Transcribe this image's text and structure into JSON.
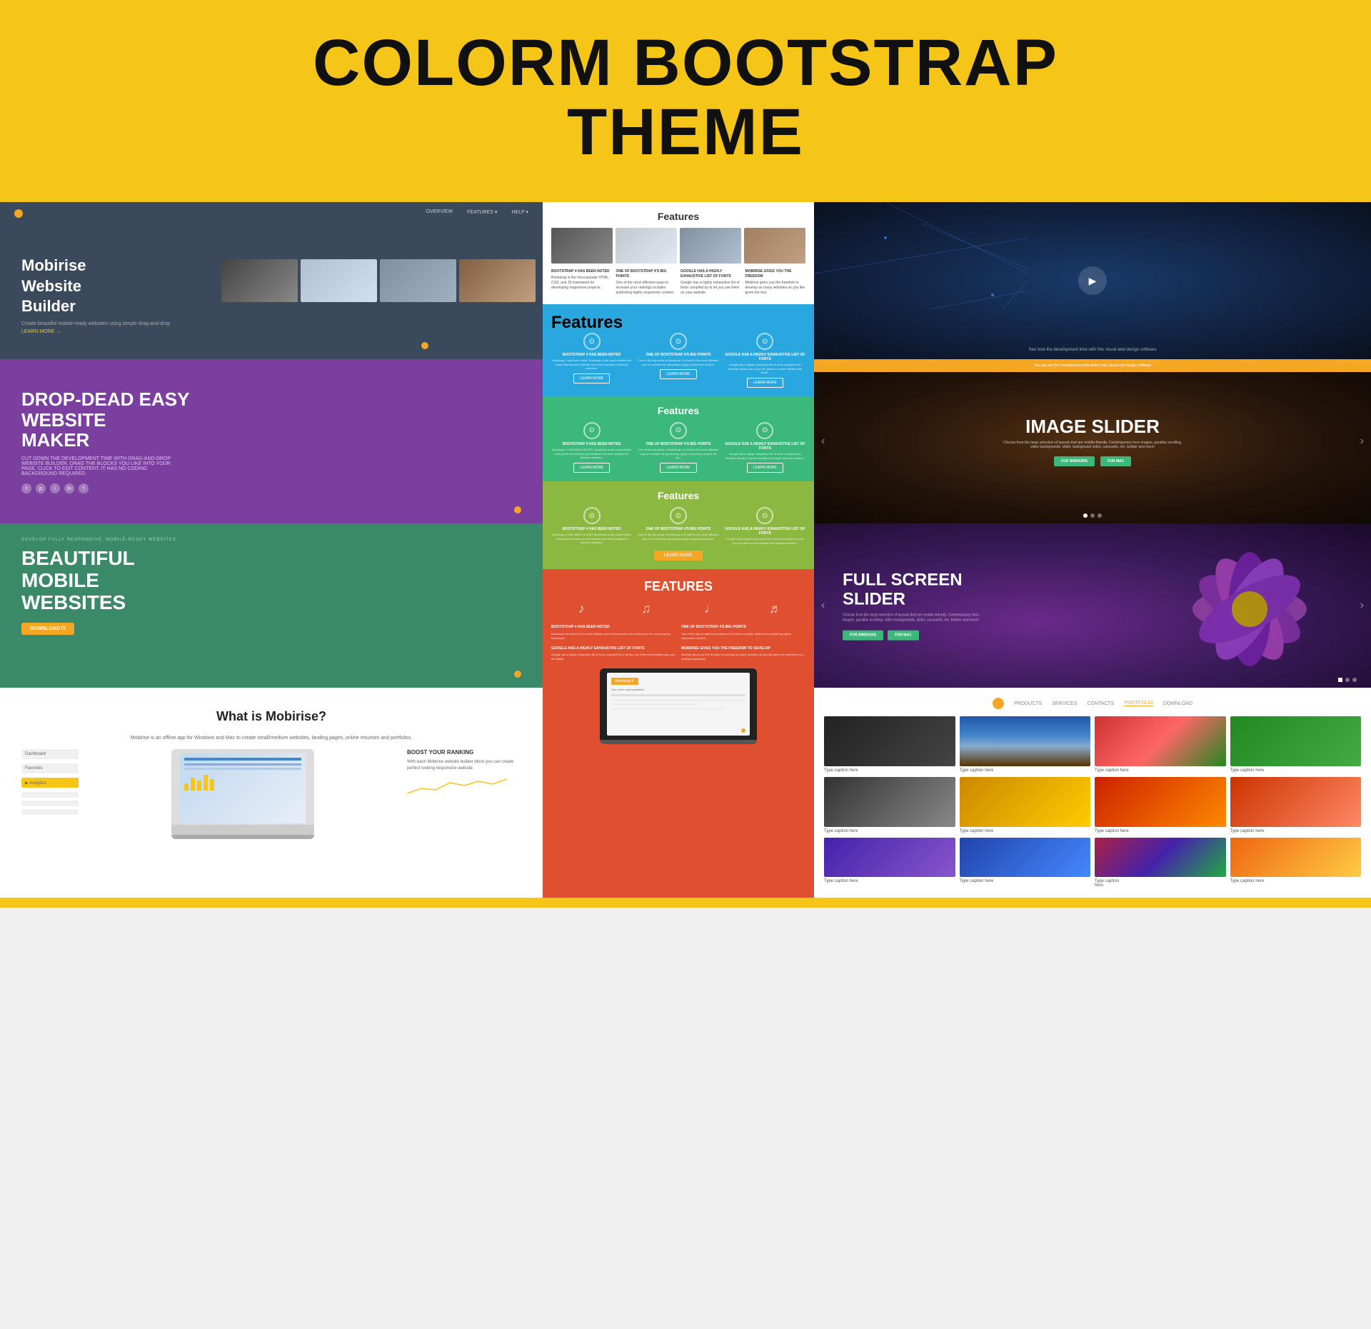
{
  "header": {
    "title": "COLORM BOOTSTRAP",
    "title2": "THEME",
    "bg": "#f5c518"
  },
  "left": {
    "mobirise": {
      "title": "Mobirise\nWebsite\nBuilder",
      "subtitle": "Create beautiful mobile-ready websites using simple drag-and-drop",
      "link": "LEARN MORE →",
      "nav": [
        "OVERVIEW",
        "FEATURES ▾",
        "HELP ▾"
      ]
    },
    "purple": {
      "heading": "DROP-DEAD EASY\nWEBSITE\nMAKER",
      "desc": "CUT DOWN THE DEVELOPMENT TIME WITH DRAG-AND-DROP WEBSITE BUILDER. DRAG THE BLOCKS YOU LIKE INTO YOUR PAGE, CLICK TO EDIT CONTENT. IT HAS NO CODING BACKGROUND REQUIRED."
    },
    "green": {
      "label": "DEVELOP FULLY RESPONSIVE, MOBILE-READY WEBSITES",
      "heading": "BEAUTIFUL\nMOBILE\nWEBSITES",
      "btn": "DOWNLOAD IT"
    },
    "white": {
      "heading": "What is Mobirise?",
      "text": "Mobirise is an offline app for Windows and Mac to create small/medium websites, landing pages, online resumes and portfolios.",
      "sidebar_items": [
        "Dashboard",
        "Favorites",
        "▶ Analytics"
      ],
      "boost_title": "BOOST YOUR RANKING",
      "boost_text": "With each Mobirise website builder block you can create perfect looking responsive website."
    }
  },
  "middle": {
    "feat1": {
      "title": "Features",
      "thumbs": [
        "office-1",
        "office-2",
        "tablet",
        "laptop"
      ],
      "cols": [
        {
          "title": "BOOTSTRAP 4 HAS BEEN NOTED",
          "text": "Bootstrap is the most popular HTML, CSS, and JS framework for developing responsive projects on the web."
        },
        {
          "title": "ONE OF BOOTSTRAP 4'S BIG POINTS",
          "text": "One of the most effective ways to increase your rankings includes publishing highly responsive content for you."
        },
        {
          "title": "GOOGLE HAS A HIGHLY EXHAUSTIVE LIST OF FONTS",
          "text": "Google has a highly exhaustive list of fonts compiled by to let you use them on publishing website."
        },
        {
          "title": "MOBIRISE GIVES YOU THE FREEDOM TO DEVELOP",
          "text": "Mobirise gives you the freedom to develop as many websites as you like given the fact that it is a desktop app."
        }
      ]
    },
    "feat2": {
      "title": "Features",
      "color": "#29a8e0",
      "items": [
        {
          "icon": "⊙",
          "title": "BOOTSTRAP 4 HAS BEEN NOTED",
          "text": "Bootstrap 4 HAS BEEN NOTED. Bootstrap is the most reliable and potent frameworks and Mobirise has been included to develop websites using this framework."
        },
        {
          "icon": "⊙",
          "title": "ONE OF BOOTSTRAP 4'S BIG POINTS",
          "text": "One of the big points of Bootstrap 4 is that it's the most effective way to increase the generating highly responsive content for you."
        },
        {
          "icon": "⊙",
          "title": "GOOGLE HAS A HIGHLY EXHAUSTIVE LIST OF FONTS",
          "text": "Google has a highly exhaustive list of fonts compiled and Mobirise allows you to let you to get an option to create website with these."
        },
        {
          "btn": "LEARN MORE"
        }
      ]
    },
    "feat3": {
      "title": "Features",
      "color": "#3cb87a"
    },
    "feat4": {
      "title": "Features",
      "color": "#8ab840",
      "btn": "LEARN MORE"
    },
    "feat5": {
      "title": "FEATURES",
      "color": "#e05030",
      "icons": [
        "♪",
        "♫",
        "♩",
        "♬"
      ],
      "cols": [
        {
          "title": "BOOTSTRAP 4 HAS BEEN NOTED",
          "text": "Bootstrap has raised to the most most reliable potent frameworks and solutions for the most popular framework."
        },
        {
          "title": "ONE OF BOOTSTRAP 4'S BIG POINTS",
          "text": "One of the big strengths of bootstrap 4 is that it is popular a platform for publishing highly responsive content for you and your content."
        },
        {
          "title": "GOOGLE HAS A HIGHLY EXHAUSTIVE LIST OF FONTS",
          "text": "Google has a highly exhaustive list of fonts compiled by to let you use them and Mobirise give you the ability to use this great list."
        },
        {
          "title": "MOBIRISE GIVES YOU THE FREEDOM TO DEVELOP",
          "text": "Mobirise gives you the freedom to develop as many websites as you like given the fact that it is a desktop application."
        }
      ],
      "laptop_badge": "Bootstrap 4",
      "laptop_text": "One of the most powerful..."
    }
  },
  "right": {
    "network": {
      "bg": "dark-blue-network",
      "play": "▶",
      "text": "See how the development time with this visual web design software"
    },
    "slider": {
      "bar_text": "You can see the Development tools which help visual web design software",
      "title": "IMAGE SLIDER",
      "desc": "Choose from the large selection of layouts that are mobile-friendly. Contemporary hero images, parallax scrolling, video backgrounds, slider, background video, carousels, etc. builder and more!",
      "btn1": "FOR WINDOWS",
      "btn2": "FOR MAC",
      "dots": [
        true,
        false,
        false
      ]
    },
    "fullscreen": {
      "title": "FULL SCREEN\nSLIDER",
      "desc": "Choose from the large selection of layouts that are mobile-friendly. Contemporary hero images, parallax scrolling, video backgrounds, slider, carousels, etc. builder and more!",
      "btn1": "FOR WINDOWS",
      "btn2": "FOR MAC"
    },
    "gallery": {
      "nav_items": [
        "▸",
        "PRODUCTS",
        "SERVICES",
        "CONTACTS",
        "PORTFOLIO",
        "DOWNLOAD"
      ],
      "rows": [
        [
          {
            "img": "dark",
            "caption": "Type caption here"
          },
          {
            "img": "lake",
            "caption": "Type caption here"
          },
          {
            "img": "berries",
            "caption": "Type caption here"
          },
          {
            "img": "green",
            "caption": "Type caption here"
          }
        ],
        [
          {
            "img": "bw",
            "caption": "Type caption here"
          },
          {
            "img": "yellow",
            "caption": "Type caption here"
          },
          {
            "img": "fire",
            "caption": "Type caption here"
          },
          {
            "img": "flowers",
            "caption": "Type caption here"
          }
        ],
        [
          {
            "img": "purple2",
            "caption": "Type caption here"
          },
          {
            "img": "blue2",
            "caption": "Type caption here"
          },
          {
            "img": "colorful",
            "caption": "Type caption\nhero"
          },
          {
            "img": "sunset",
            "caption": "Type caption here"
          }
        ]
      ]
    }
  }
}
